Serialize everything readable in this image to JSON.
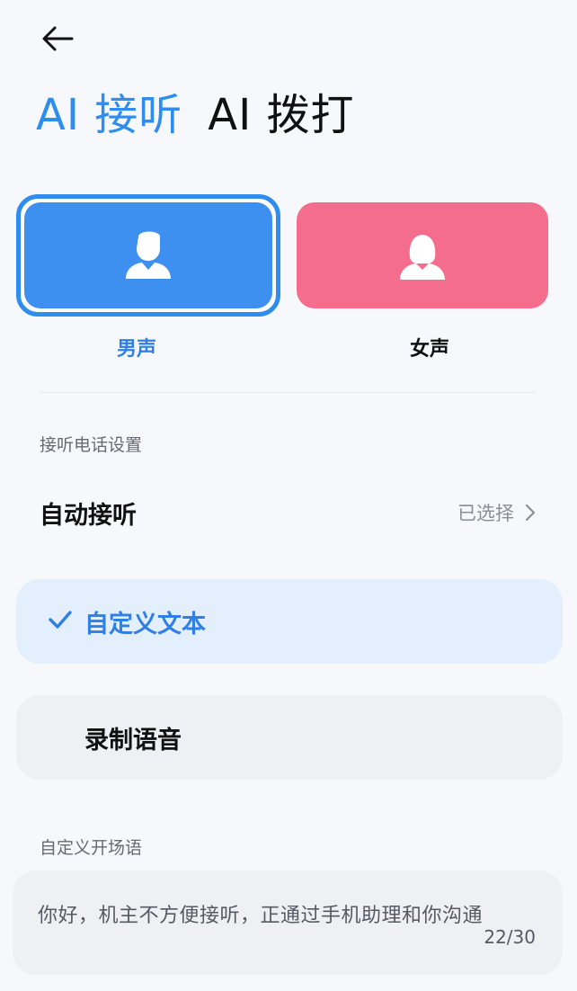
{
  "header": {
    "back_icon": "arrow-left-icon"
  },
  "tabs": [
    {
      "label": "AI 接听",
      "active": true
    },
    {
      "label": "AI 拨打",
      "active": false
    }
  ],
  "voices": {
    "male": {
      "label": "男声",
      "icon": "male-person-icon",
      "color": "#3d8ff0",
      "selected": true
    },
    "female": {
      "label": "女声",
      "icon": "female-person-icon",
      "color": "#f56d8c",
      "selected": false
    }
  },
  "settings": {
    "section_title": "接听电话设置",
    "auto_answer": {
      "title": "自动接听",
      "value": "已选择"
    }
  },
  "options": [
    {
      "label": "自定义文本",
      "selected": true
    },
    {
      "label": "录制语音",
      "selected": false
    }
  ],
  "greeting": {
    "section_title": "自定义开场语",
    "text": "你好，机主不方便接听，正通过手机助理和你沟通",
    "counter": "22/30"
  },
  "colors": {
    "accent": "#2f8df0",
    "female": "#f56d8c"
  }
}
